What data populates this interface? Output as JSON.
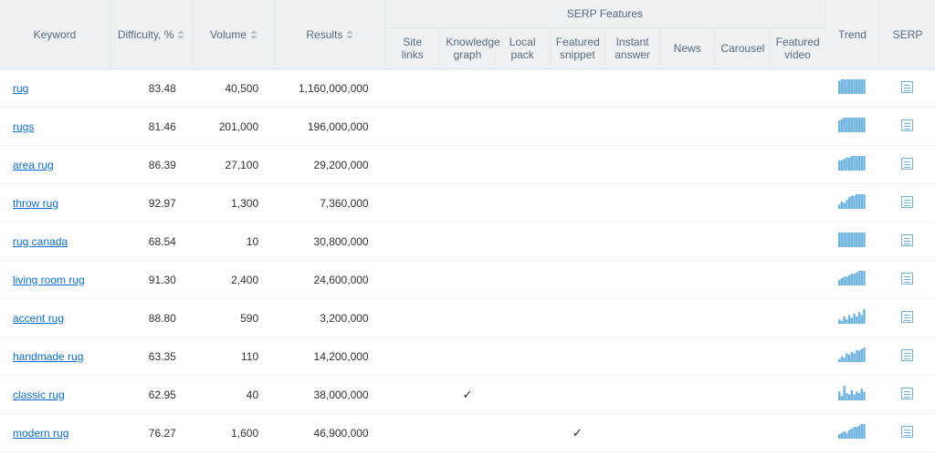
{
  "headers": {
    "keyword": "Keyword",
    "difficulty": "Difficulty, %",
    "volume": "Volume",
    "results": "Results",
    "serp_group": "SERP Features",
    "trend": "Trend",
    "serp": "SERP",
    "features": {
      "site_links": "Site links",
      "knowledge_graph": "Knowledge graph",
      "local_pack": "Local pack",
      "featured_snippet": "Featured snippet",
      "instant_answer": "Instant answer",
      "news": "News",
      "carousel": "Carousel",
      "featured_video": "Featured video"
    }
  },
  "rows": [
    {
      "keyword": "rug",
      "difficulty": "83.48",
      "volume": "40,500",
      "results": "1,160,000,000",
      "knowledge_graph": false,
      "featured_snippet": false,
      "trend": [
        9,
        10,
        10,
        10,
        10,
        10,
        10,
        10,
        10,
        10,
        10
      ]
    },
    {
      "keyword": "rugs",
      "difficulty": "81.46",
      "volume": "201,000",
      "results": "196,000,000",
      "knowledge_graph": false,
      "featured_snippet": false,
      "trend": [
        8,
        9,
        10,
        10,
        10,
        10,
        10,
        10,
        10,
        10,
        10
      ]
    },
    {
      "keyword": "area rug",
      "difficulty": "86.39",
      "volume": "27,100",
      "results": "29,200,000",
      "knowledge_graph": false,
      "featured_snippet": false,
      "trend": [
        7,
        7,
        8,
        9,
        9,
        10,
        10,
        10,
        10,
        10,
        10
      ]
    },
    {
      "keyword": "throw rug",
      "difficulty": "92.97",
      "volume": "1,300",
      "results": "7,360,000",
      "knowledge_graph": false,
      "featured_snippet": false,
      "trend": [
        3,
        5,
        4,
        6,
        8,
        9,
        9,
        10,
        10,
        10,
        10
      ]
    },
    {
      "keyword": "rug canada",
      "difficulty": "68.54",
      "volume": "10",
      "results": "30,800,000",
      "knowledge_graph": false,
      "featured_snippet": false,
      "trend": [
        10,
        10,
        10,
        10,
        10,
        10,
        10,
        10,
        10,
        10,
        10
      ]
    },
    {
      "keyword": "living room rug",
      "difficulty": "91.30",
      "volume": "2,400",
      "results": "24,600,000",
      "knowledge_graph": false,
      "featured_snippet": false,
      "trend": [
        4,
        5,
        6,
        6,
        7,
        8,
        8,
        9,
        10,
        10,
        10
      ]
    },
    {
      "keyword": "accent rug",
      "difficulty": "88.80",
      "volume": "590",
      "results": "3,200,000",
      "knowledge_graph": false,
      "featured_snippet": false,
      "trend": [
        3,
        2,
        5,
        3,
        6,
        4,
        7,
        5,
        8,
        6,
        10
      ]
    },
    {
      "keyword": "handmade rug",
      "difficulty": "63.35",
      "volume": "110",
      "results": "14,200,000",
      "knowledge_graph": false,
      "featured_snippet": false,
      "trend": [
        2,
        4,
        3,
        6,
        5,
        7,
        6,
        8,
        8,
        9,
        10
      ]
    },
    {
      "keyword": "classic rug",
      "difficulty": "62.95",
      "volume": "40",
      "results": "38,000,000",
      "knowledge_graph": true,
      "featured_snippet": false,
      "trend": [
        6,
        3,
        10,
        5,
        4,
        7,
        4,
        6,
        5,
        8,
        6
      ]
    },
    {
      "keyword": "modern rug",
      "difficulty": "76.27",
      "volume": "1,600",
      "results": "46,900,000",
      "knowledge_graph": false,
      "featured_snippet": true,
      "trend": [
        3,
        4,
        5,
        4,
        6,
        7,
        8,
        8,
        9,
        10,
        10
      ]
    }
  ]
}
